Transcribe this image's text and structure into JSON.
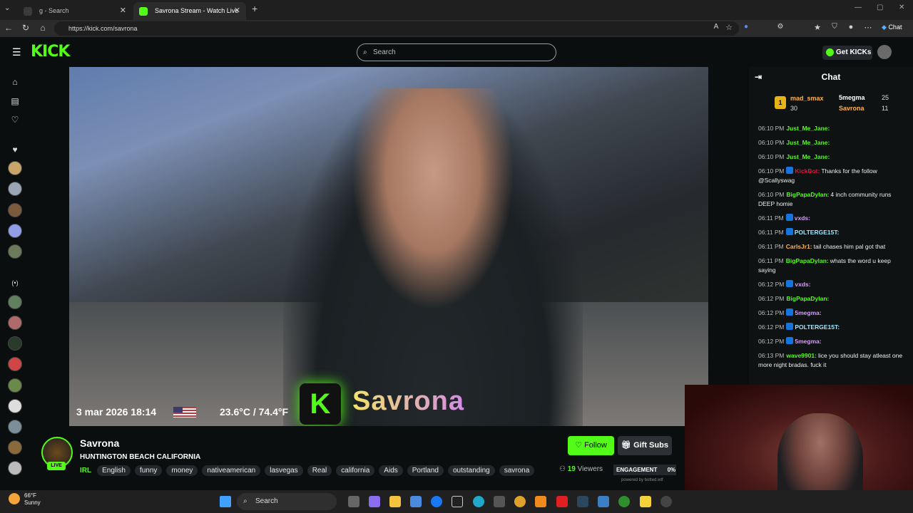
{
  "browser": {
    "tabs": [
      {
        "label": "g - Search",
        "active": false
      },
      {
        "label": "Savrona Stream - Watch Live on Kick",
        "active": true
      }
    ],
    "url": "https://kick.com/savrona",
    "profile_button": "Chat"
  },
  "header": {
    "logo": "KICK",
    "search_placeholder": "Search",
    "get_kicks_label": "Get KICKs"
  },
  "video_overlay": {
    "datetime": "3 mar 2026 18:14",
    "temperature": "23.6°C / 74.4°F",
    "streamer_k": "K",
    "streamer_name": "Savrona"
  },
  "channel": {
    "name": "Savrona",
    "title": "HUNTINGTON BEACH CALIFORNIA",
    "live_badge": "LIVE",
    "category": "IRL",
    "tags": [
      "English",
      "funny",
      "money",
      "nativeamerican",
      "lasvegas",
      "Real",
      "california",
      "Aids",
      "Portland",
      "outstanding",
      "savrona"
    ],
    "follow_label": "Follow",
    "gift_subs_label": "Gift Subs",
    "viewers_count": "19",
    "viewers_label": "Viewers",
    "engagement_label": "ENGAGEMENT",
    "engagement_value": "0%",
    "powered_by": "powered by botted.wtf"
  },
  "chat": {
    "title": "Chat",
    "leaderboard": [
      {
        "rank": "1",
        "name": "mad_smax",
        "count": "30"
      },
      {
        "rank": "",
        "name": "5megma",
        "count": "25"
      },
      {
        "rank": "",
        "name": "Savrona",
        "count": "11"
      }
    ],
    "messages": [
      {
        "time": "06:10 PM",
        "user": "Just_Me_Jane:",
        "user_color": "#53fc18",
        "text": "",
        "badge_color": ""
      },
      {
        "time": "06:10 PM",
        "user": "Just_Me_Jane:",
        "user_color": "#53fc18",
        "text": "",
        "badge_color": ""
      },
      {
        "time": "06:10 PM",
        "user": "Just_Me_Jane:",
        "user_color": "#53fc18",
        "text": "",
        "badge_color": ""
      },
      {
        "time": "06:10 PM",
        "user": "KickBot:",
        "user_color": "#e9113c",
        "text": "Thanks for the follow @Scallyswag",
        "badge_color": "#1475e1"
      },
      {
        "time": "06:10 PM",
        "user": "BigPapaDylan:",
        "user_color": "#53fc18",
        "text": "4 inch community runs DEEP homie",
        "badge_color": ""
      },
      {
        "time": "06:11 PM",
        "user": "vxds:",
        "user_color": "#d89cff",
        "text": "",
        "badge_color": "#1475e1"
      },
      {
        "time": "06:11 PM",
        "user": "POLTERGE15T:",
        "user_color": "#a0e7ff",
        "text": "",
        "badge_color": "#1475e1"
      },
      {
        "time": "06:11 PM",
        "user": "CarlsJr1:",
        "user_color": "#ffb347",
        "text": "tail chases him pal got that",
        "badge_color": ""
      },
      {
        "time": "06:11 PM",
        "user": "BigPapaDylan:",
        "user_color": "#53fc18",
        "text": "whats the word u keep saying",
        "badge_color": ""
      },
      {
        "time": "06:12 PM",
        "user": "vxds:",
        "user_color": "#d89cff",
        "text": "",
        "badge_color": "#1475e1"
      },
      {
        "time": "06:12 PM",
        "user": "BigPapaDylan:",
        "user_color": "#53fc18",
        "text": "",
        "badge_color": ""
      },
      {
        "time": "06:12 PM",
        "user": "5megma:",
        "user_color": "#d89cff",
        "text": "",
        "badge_color": "#1475e1"
      },
      {
        "time": "06:12 PM",
        "user": "POLTERGE15T:",
        "user_color": "#a0e7ff",
        "text": "",
        "badge_color": "#1475e1"
      },
      {
        "time": "06:12 PM",
        "user": "5megma:",
        "user_color": "#d89cff",
        "text": "",
        "badge_color": "#1475e1"
      },
      {
        "time": "06:13 PM",
        "user": "wave9901:",
        "user_color": "#53fc18",
        "text": "lice you should stay atleast one more night bradas. fuck it",
        "badge_color": ""
      }
    ]
  },
  "taskbar": {
    "weather_temp": "66°F",
    "weather_desc": "Sunny",
    "search_label": "Search"
  },
  "colors": {
    "accent": "#53fc18",
    "background": "#0b0e0f"
  }
}
